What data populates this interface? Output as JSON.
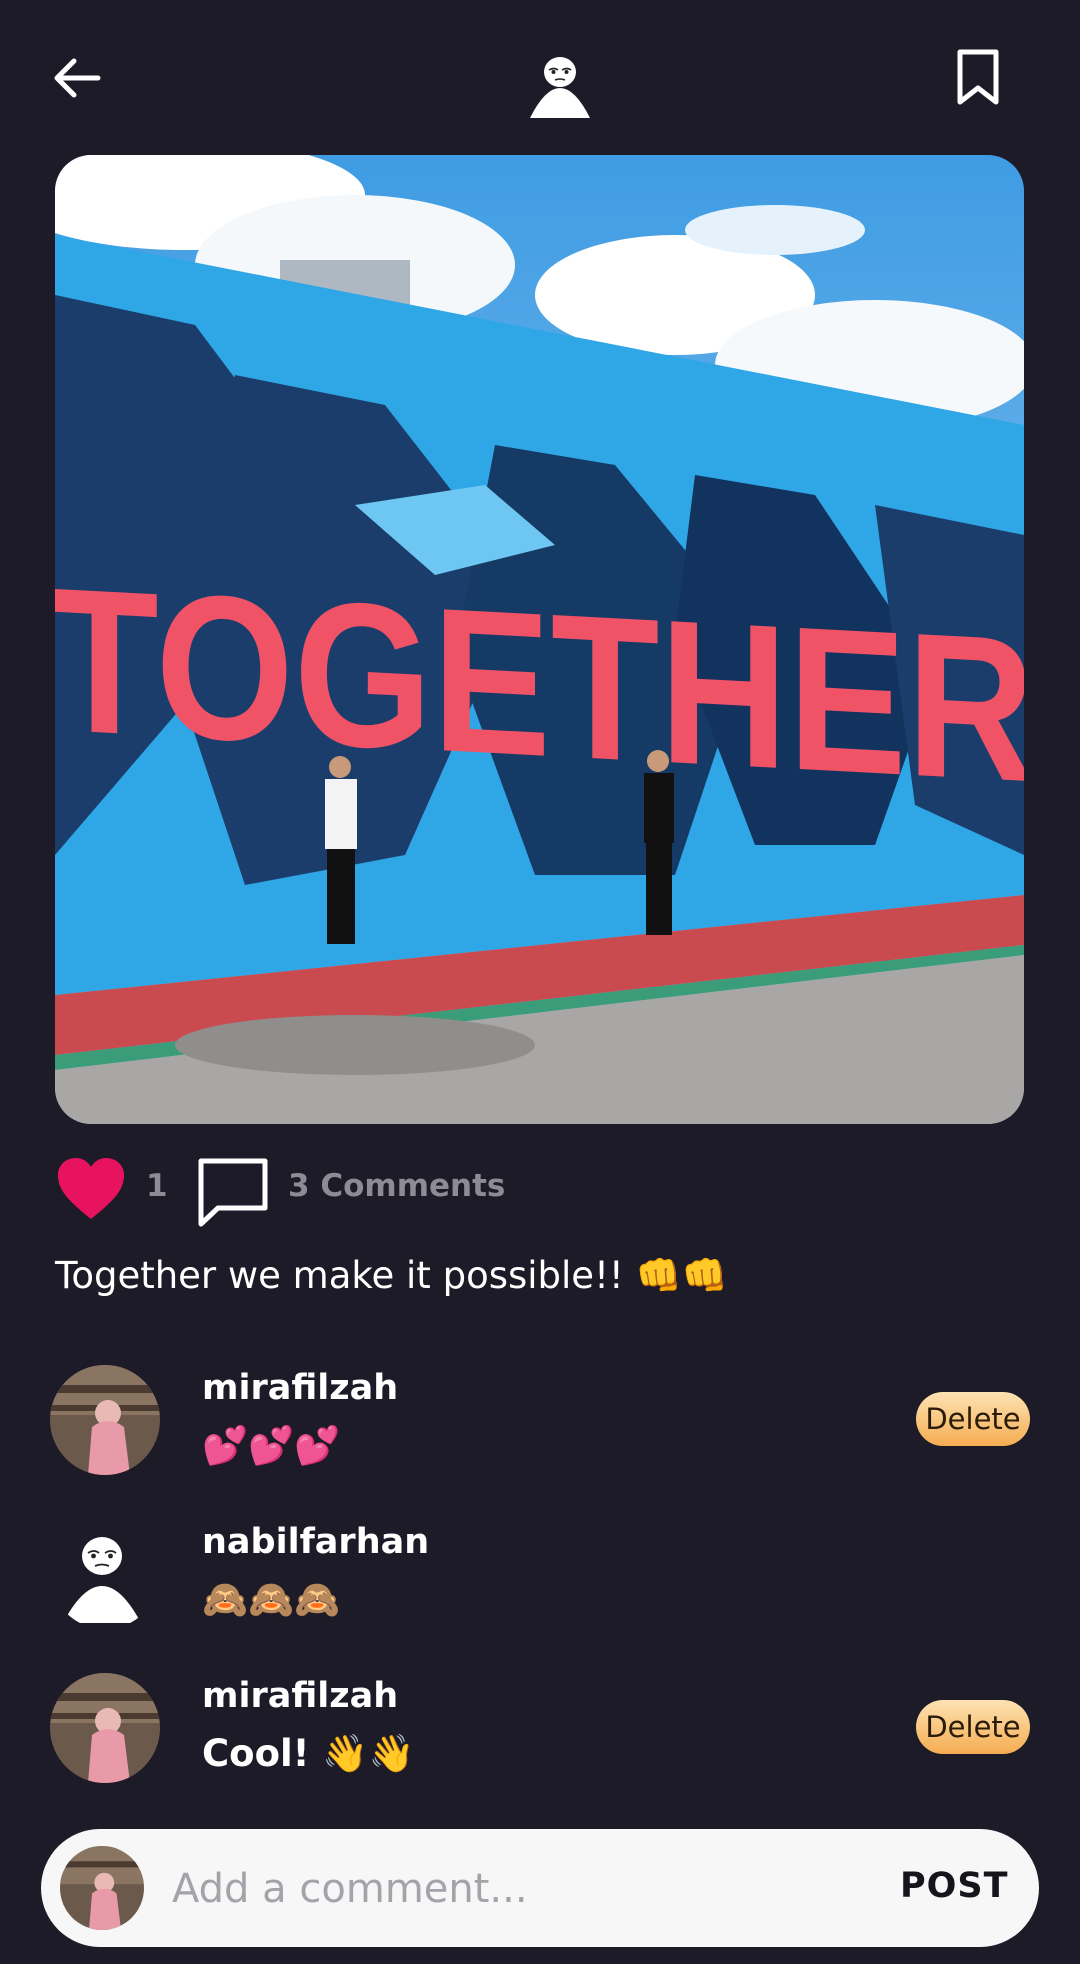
{
  "header": {
    "back_icon": "arrow-left-icon",
    "bookmark_icon": "bookmark-icon",
    "avatar_icon": "default-user-avatar"
  },
  "post": {
    "image_text": "TOGETHER",
    "likes_count": "1",
    "comments_count_label": "3 Comments",
    "caption": "Together we make it possible!! 👊👊",
    "liked": true,
    "like_color": "#e8135f"
  },
  "comments": [
    {
      "username": "mirafilzah",
      "text": "💕💕💕",
      "delete_label": "Delete",
      "avatar": "photo-avatar"
    },
    {
      "username": "nabilfarhan",
      "text": "🙈🙈🙈",
      "avatar": "default-user-avatar"
    },
    {
      "username": "mirafilzah",
      "text": "Cool! 👋👋",
      "delete_label": "Delete",
      "avatar": "photo-avatar"
    }
  ],
  "composer": {
    "placeholder": "Add a comment...",
    "post_label": "POST"
  },
  "colors": {
    "background": "#1d1b27",
    "delete_gradient_top": "#fde3b3",
    "delete_gradient_bottom": "#f5ad52"
  }
}
